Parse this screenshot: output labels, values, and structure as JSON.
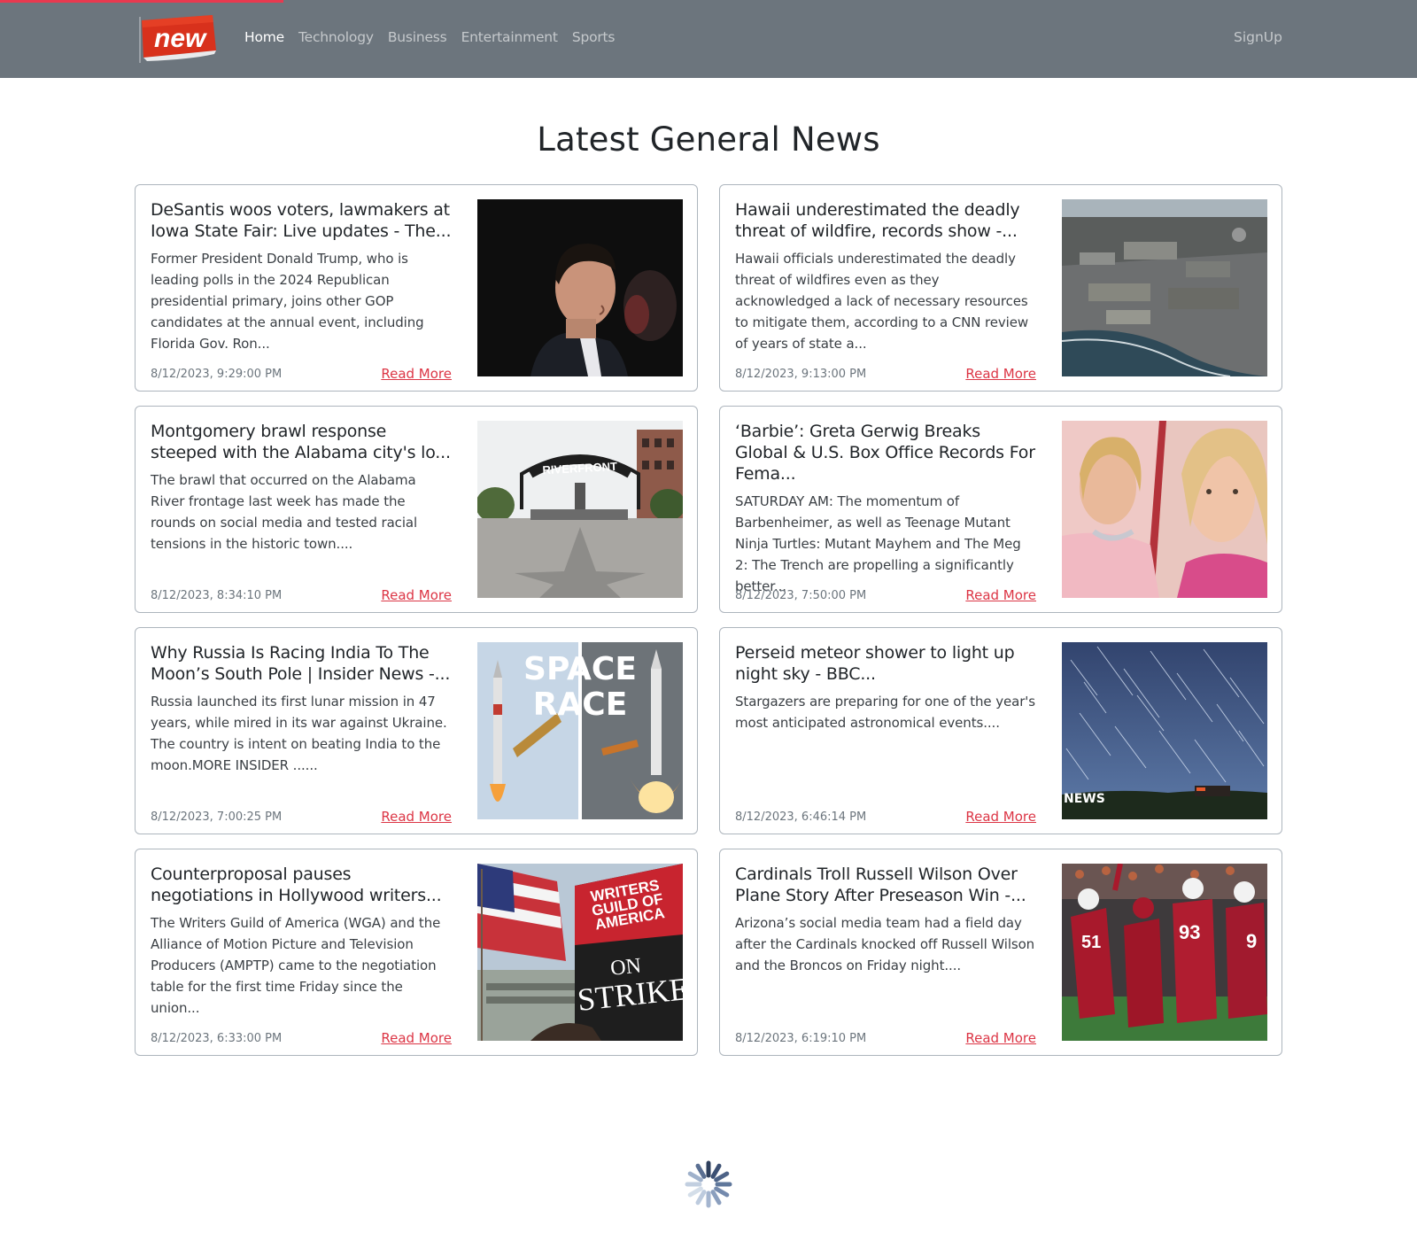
{
  "navbar": {
    "brand": "new",
    "links": [
      "Home",
      "Technology",
      "Business",
      "Entertainment",
      "Sports"
    ],
    "signup": "SignUp"
  },
  "page": {
    "title": "Latest General News"
  },
  "articles": [
    {
      "title": "DeSantis woos voters, lawmakers at Iowa State Fair: Live updates - The...",
      "description": "Former President Donald Trump, who is leading polls in the 2024 Republican presidential primary, joins other GOP candidates at the annual event, including Florida Gov. Ron...",
      "date": "8/12/2023, 9:29:00 PM",
      "read_more": "Read More"
    },
    {
      "title": "Hawaii underestimated the deadly threat of wildfire, records show -...",
      "description": "Hawaii officials underestimated the deadly threat of wildfires even as they acknowledged a lack of necessary resources to mitigate them, according to a CNN review of years of state a...",
      "date": "8/12/2023, 9:13:00 PM",
      "read_more": "Read More"
    },
    {
      "title": "Montgomery brawl response steeped with the Alabama city's lo...",
      "description": "The brawl that occurred on the Alabama River frontage last week has made the rounds on social media and tested racial tensions in the historic town....",
      "date": "8/12/2023, 8:34:10 PM",
      "read_more": "Read More",
      "image_text": [
        "RIVERFRONT"
      ]
    },
    {
      "title": "‘Barbie’: Greta Gerwig Breaks Global & U.S. Box Office Records For Fema...",
      "description": "SATURDAY AM: The momentum of Barbenheimer, as well as Teenage Mutant Ninja Turtles: Mutant Mayhem and The Meg 2: The Trench are propelling a significantly better...",
      "date": "8/12/2023, 7:50:00 PM",
      "read_more": "Read More"
    },
    {
      "title": "Why Russia Is Racing India To The Moon’s South Pole | Insider News -...",
      "description": "Russia launched its first lunar mission in 47 years, while mired in its war against Ukraine. The country is intent on beating India to the moon.MORE INSIDER ......",
      "date": "8/12/2023, 7:00:25 PM",
      "read_more": "Read More",
      "image_text": [
        "SPACE",
        "RACE"
      ]
    },
    {
      "title": "Perseid meteor shower to light up night sky - BBC...",
      "description": "Stargazers are preparing for one of the year's most anticipated astronomical events....",
      "date": "8/12/2023, 6:46:14 PM",
      "read_more": "Read More",
      "image_text": [
        "NEWS"
      ]
    },
    {
      "title": "Counterproposal pauses negotiations in Hollywood writers...",
      "description": "The Writers Guild of America (WGA) and the Alliance of Motion Picture and Television Producers (AMPTP) came to the negotiation table for the first time Friday since the union...",
      "date": "8/12/2023, 6:33:00 PM",
      "read_more": "Read More",
      "image_text": [
        "WRITERS",
        "GUILD OF",
        "AMERICA",
        "ON",
        "STRIKE"
      ]
    },
    {
      "title": "Cardinals Troll Russell Wilson Over Plane Story After Preseason Win -...",
      "description": "Arizona’s social media team had a field day after the Cardinals knocked off Russell Wilson and the Broncos on Friday night....",
      "date": "8/12/2023, 6:19:10 PM",
      "read_more": "Read More",
      "image_text": [
        "51",
        "93",
        "9"
      ]
    }
  ],
  "colors": {
    "navbar_bg": "#6c757d",
    "accent_red": "#dc3545",
    "progress": "#e8394f"
  },
  "icons": {
    "loading": "spinner-icon",
    "brand": "new-flag-logo"
  }
}
